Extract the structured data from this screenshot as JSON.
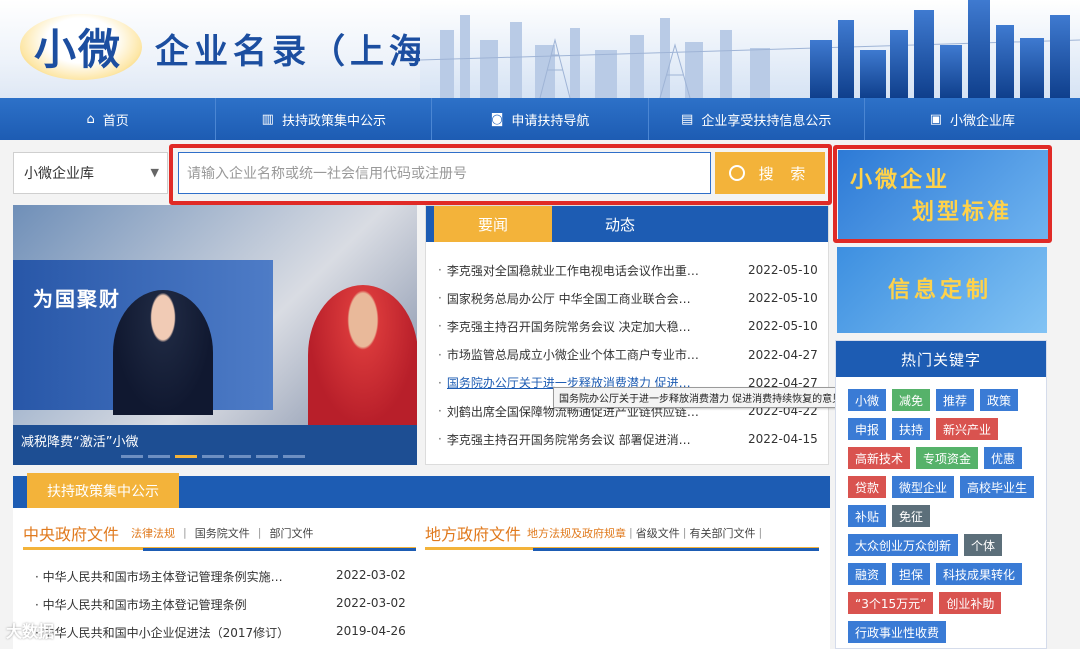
{
  "header": {
    "logo_text": "小微",
    "site_title": "企业名录（上海）"
  },
  "nav": [
    {
      "icon": "home-icon",
      "glyph": "⌂",
      "label": "首页"
    },
    {
      "icon": "book-icon",
      "glyph": "▥",
      "label": "扶持政策集中公示"
    },
    {
      "icon": "compass-icon",
      "glyph": "◙",
      "label": "申请扶持导航"
    },
    {
      "icon": "clipboard-icon",
      "glyph": "▤",
      "label": "企业享受扶持信息公示"
    },
    {
      "icon": "list-icon",
      "glyph": "▣",
      "label": "小微企业库"
    }
  ],
  "search": {
    "select_value": "小微企业库",
    "placeholder": "请输入企业名称或统一社会信用代码或注册号",
    "button_label": "搜 索"
  },
  "banners": {
    "standard_line1": "小微企业",
    "standard_line2": "划型标准",
    "custom": "信息定制"
  },
  "carousel": {
    "wall_text": "为国聚财",
    "caption": "减税降费“激活”小微"
  },
  "news": {
    "tabs": [
      "要闻",
      "动态"
    ],
    "items": [
      {
        "title": "李克强对全国稳就业工作电视电话会议作出重…",
        "date": "2022-05-10"
      },
      {
        "title": "国家税务总局办公厅 中华全国工商业联合会…",
        "date": "2022-05-10"
      },
      {
        "title": "李克强主持召开国务院常务会议 决定加大稳…",
        "date": "2022-05-10"
      },
      {
        "title": "市场监管总局成立小微企业个体工商户专业市…",
        "date": "2022-04-27"
      },
      {
        "title": "国务院办公厅关于进一步释放消费潜力 促进…",
        "date": "2022-04-27"
      },
      {
        "title": "刘鹤出席全国保障物流畅通促进产业链供应链…",
        "date": "2022-04-22"
      },
      {
        "title": "李克强主持召开国务院常务会议 部署促进消…",
        "date": "2022-04-15"
      }
    ],
    "tooltip": "国务院办公厅关于进一步释放消费潜力 促进消费持续恢复的意见"
  },
  "hot": {
    "title": "热门关键字",
    "tags": [
      {
        "label": "小微",
        "color": "#3a7bd5"
      },
      {
        "label": "减免",
        "color": "#56b26a"
      },
      {
        "label": "推荐",
        "color": "#3a7bd5"
      },
      {
        "label": "政策",
        "color": "#3a7bd5"
      },
      {
        "label": "申报",
        "color": "#3a7bd5"
      },
      {
        "label": "扶持",
        "color": "#3a7bd5"
      },
      {
        "label": "新兴产业",
        "color": "#d9534f"
      },
      {
        "label": "高新技术",
        "color": "#d9534f"
      },
      {
        "label": "专项资金",
        "color": "#56b26a"
      },
      {
        "label": "优惠",
        "color": "#3a7bd5"
      },
      {
        "label": "贷款",
        "color": "#d9534f"
      },
      {
        "label": "微型企业",
        "color": "#3a7bd5"
      },
      {
        "label": "高校毕业生",
        "color": "#3a7bd5"
      },
      {
        "label": "补贴",
        "color": "#3a7bd5"
      },
      {
        "label": "免征",
        "color": "#5c6f7a"
      },
      {
        "label": "大众创业万众创新",
        "color": "#3a7bd5"
      },
      {
        "label": "个体",
        "color": "#5c6f7a"
      },
      {
        "label": "融资",
        "color": "#3a7bd5"
      },
      {
        "label": "担保",
        "color": "#3a7bd5"
      },
      {
        "label": "科技成果转化",
        "color": "#3a7bd5"
      },
      {
        "label": "“3个15万元”",
        "color": "#d9534f"
      },
      {
        "label": "创业补助",
        "color": "#d9534f"
      },
      {
        "label": "行政事业性收费",
        "color": "#3a7bd5"
      }
    ]
  },
  "policy": {
    "title": "扶持政策集中公示",
    "central": {
      "title": "中央政府文件",
      "sub1": "法律法规",
      "sub2": "国务院文件",
      "sub3": "部门文件"
    },
    "local": {
      "title": "地方政府文件",
      "sub1": "地方法规及政府规章",
      "sub2": "省级文件",
      "sub3": "有关部门文件"
    },
    "items": [
      {
        "title": "中华人民共和国市场主体登记管理条例实施…",
        "date": "2022-03-02"
      },
      {
        "title": "中华人民共和国市场主体登记管理条例",
        "date": "2022-03-02"
      },
      {
        "title": "中华人民共和国中小企业促进法（2017修订）",
        "date": "2019-04-26"
      }
    ]
  },
  "watermark": "大数据",
  "colors": {
    "nav_blue": "#1d5cb3",
    "accent_gold": "#f3b33a",
    "highlight_red": "#e02a26",
    "brand_blue": "#1c4ea0"
  }
}
